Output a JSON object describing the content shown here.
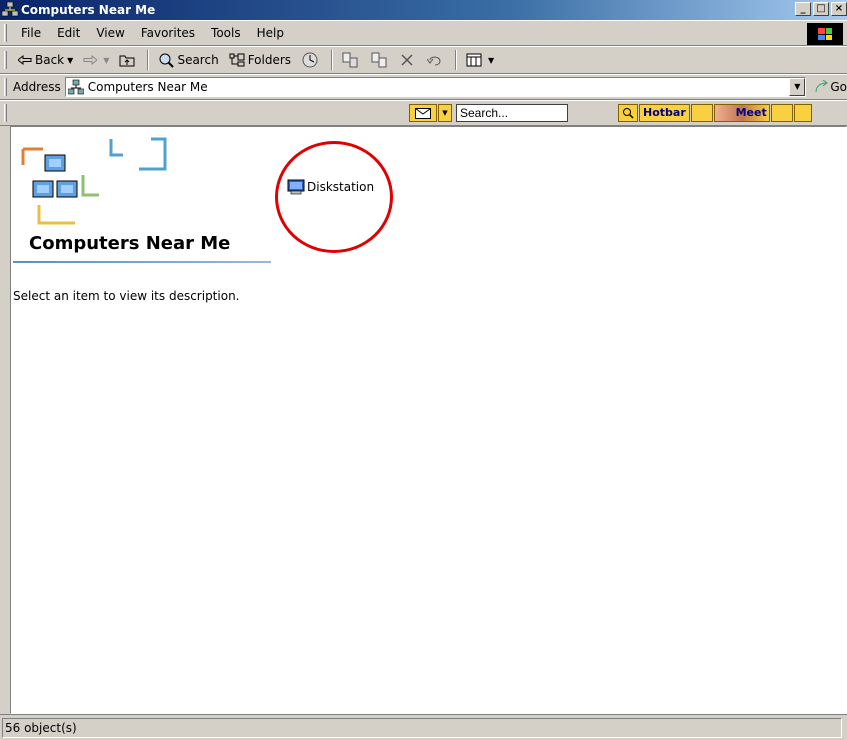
{
  "window": {
    "title": "Computers Near Me"
  },
  "menu": {
    "items": [
      "File",
      "Edit",
      "View",
      "Favorites",
      "Tools",
      "Help"
    ]
  },
  "toolbar": {
    "back": "Back",
    "search": "Search",
    "folders": "Folders"
  },
  "address": {
    "label": "Address",
    "value": "Computers Near Me",
    "go": "Go"
  },
  "hotbar": {
    "search_placeholder": "Search...",
    "hotbar_label": "Hotbar",
    "meet_label": "Meet"
  },
  "content": {
    "title": "Computers Near Me",
    "description": "Select an item to view its description.",
    "items": [
      {
        "label": "Diskstation",
        "icon": "computer-icon"
      }
    ]
  },
  "status": {
    "text": "56 object(s)"
  },
  "colors": {
    "titlebar": "#0a246a",
    "highlight": "#e00000",
    "chrome": "#d4d0c8"
  }
}
